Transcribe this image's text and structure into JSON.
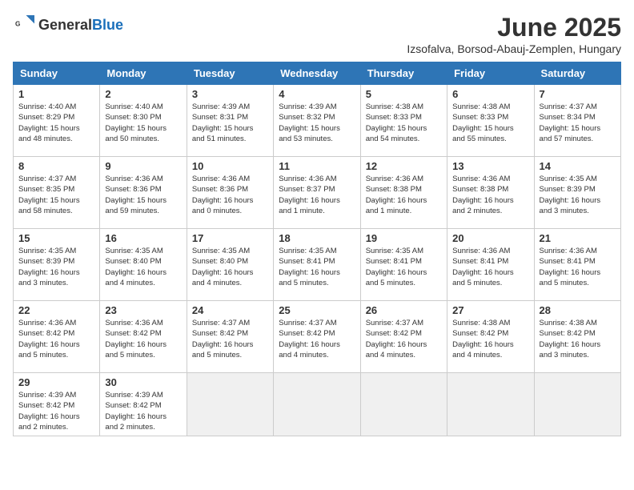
{
  "header": {
    "logo_general": "General",
    "logo_blue": "Blue",
    "month_title": "June 2025",
    "location": "Izsofalva, Borsod-Abauj-Zemplen, Hungary"
  },
  "days_of_week": [
    "Sunday",
    "Monday",
    "Tuesday",
    "Wednesday",
    "Thursday",
    "Friday",
    "Saturday"
  ],
  "weeks": [
    [
      {
        "day": "1",
        "info": "Sunrise: 4:40 AM\nSunset: 8:29 PM\nDaylight: 15 hours\nand 48 minutes."
      },
      {
        "day": "2",
        "info": "Sunrise: 4:40 AM\nSunset: 8:30 PM\nDaylight: 15 hours\nand 50 minutes."
      },
      {
        "day": "3",
        "info": "Sunrise: 4:39 AM\nSunset: 8:31 PM\nDaylight: 15 hours\nand 51 minutes."
      },
      {
        "day": "4",
        "info": "Sunrise: 4:39 AM\nSunset: 8:32 PM\nDaylight: 15 hours\nand 53 minutes."
      },
      {
        "day": "5",
        "info": "Sunrise: 4:38 AM\nSunset: 8:33 PM\nDaylight: 15 hours\nand 54 minutes."
      },
      {
        "day": "6",
        "info": "Sunrise: 4:38 AM\nSunset: 8:33 PM\nDaylight: 15 hours\nand 55 minutes."
      },
      {
        "day": "7",
        "info": "Sunrise: 4:37 AM\nSunset: 8:34 PM\nDaylight: 15 hours\nand 57 minutes."
      }
    ],
    [
      {
        "day": "8",
        "info": "Sunrise: 4:37 AM\nSunset: 8:35 PM\nDaylight: 15 hours\nand 58 minutes."
      },
      {
        "day": "9",
        "info": "Sunrise: 4:36 AM\nSunset: 8:36 PM\nDaylight: 15 hours\nand 59 minutes."
      },
      {
        "day": "10",
        "info": "Sunrise: 4:36 AM\nSunset: 8:36 PM\nDaylight: 16 hours\nand 0 minutes."
      },
      {
        "day": "11",
        "info": "Sunrise: 4:36 AM\nSunset: 8:37 PM\nDaylight: 16 hours\nand 1 minute."
      },
      {
        "day": "12",
        "info": "Sunrise: 4:36 AM\nSunset: 8:38 PM\nDaylight: 16 hours\nand 1 minute."
      },
      {
        "day": "13",
        "info": "Sunrise: 4:36 AM\nSunset: 8:38 PM\nDaylight: 16 hours\nand 2 minutes."
      },
      {
        "day": "14",
        "info": "Sunrise: 4:35 AM\nSunset: 8:39 PM\nDaylight: 16 hours\nand 3 minutes."
      }
    ],
    [
      {
        "day": "15",
        "info": "Sunrise: 4:35 AM\nSunset: 8:39 PM\nDaylight: 16 hours\nand 3 minutes."
      },
      {
        "day": "16",
        "info": "Sunrise: 4:35 AM\nSunset: 8:40 PM\nDaylight: 16 hours\nand 4 minutes."
      },
      {
        "day": "17",
        "info": "Sunrise: 4:35 AM\nSunset: 8:40 PM\nDaylight: 16 hours\nand 4 minutes."
      },
      {
        "day": "18",
        "info": "Sunrise: 4:35 AM\nSunset: 8:41 PM\nDaylight: 16 hours\nand 5 minutes."
      },
      {
        "day": "19",
        "info": "Sunrise: 4:35 AM\nSunset: 8:41 PM\nDaylight: 16 hours\nand 5 minutes."
      },
      {
        "day": "20",
        "info": "Sunrise: 4:36 AM\nSunset: 8:41 PM\nDaylight: 16 hours\nand 5 minutes."
      },
      {
        "day": "21",
        "info": "Sunrise: 4:36 AM\nSunset: 8:41 PM\nDaylight: 16 hours\nand 5 minutes."
      }
    ],
    [
      {
        "day": "22",
        "info": "Sunrise: 4:36 AM\nSunset: 8:42 PM\nDaylight: 16 hours\nand 5 minutes."
      },
      {
        "day": "23",
        "info": "Sunrise: 4:36 AM\nSunset: 8:42 PM\nDaylight: 16 hours\nand 5 minutes."
      },
      {
        "day": "24",
        "info": "Sunrise: 4:37 AM\nSunset: 8:42 PM\nDaylight: 16 hours\nand 5 minutes."
      },
      {
        "day": "25",
        "info": "Sunrise: 4:37 AM\nSunset: 8:42 PM\nDaylight: 16 hours\nand 4 minutes."
      },
      {
        "day": "26",
        "info": "Sunrise: 4:37 AM\nSunset: 8:42 PM\nDaylight: 16 hours\nand 4 minutes."
      },
      {
        "day": "27",
        "info": "Sunrise: 4:38 AM\nSunset: 8:42 PM\nDaylight: 16 hours\nand 4 minutes."
      },
      {
        "day": "28",
        "info": "Sunrise: 4:38 AM\nSunset: 8:42 PM\nDaylight: 16 hours\nand 3 minutes."
      }
    ],
    [
      {
        "day": "29",
        "info": "Sunrise: 4:39 AM\nSunset: 8:42 PM\nDaylight: 16 hours\nand 2 minutes."
      },
      {
        "day": "30",
        "info": "Sunrise: 4:39 AM\nSunset: 8:42 PM\nDaylight: 16 hours\nand 2 minutes."
      },
      {
        "day": "",
        "info": ""
      },
      {
        "day": "",
        "info": ""
      },
      {
        "day": "",
        "info": ""
      },
      {
        "day": "",
        "info": ""
      },
      {
        "day": "",
        "info": ""
      }
    ]
  ]
}
